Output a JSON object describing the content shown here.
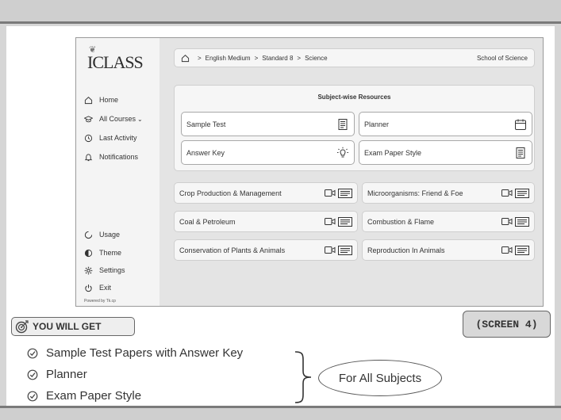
{
  "app": {
    "logo": "ICLASS",
    "sidebar": {
      "top_items": [
        {
          "label": "Home",
          "icon": "home-icon"
        },
        {
          "label": "All Courses",
          "icon": "graduation-cap-icon"
        },
        {
          "label": "Last Activity",
          "icon": "history-icon"
        },
        {
          "label": "Notifications",
          "icon": "bell-icon"
        }
      ],
      "bottom_items": [
        {
          "label": "Usage",
          "icon": "pie-chart-icon"
        },
        {
          "label": "Theme",
          "icon": "contrast-icon"
        },
        {
          "label": "Settings",
          "icon": "gear-icon"
        },
        {
          "label": "Exit",
          "icon": "power-icon"
        }
      ],
      "powered_by": "Powered by Tk.cp"
    },
    "breadcrumb": {
      "items": [
        "English Medium",
        "Standard 8",
        "Science"
      ],
      "separator": ">",
      "school": "School of Science"
    },
    "resources": {
      "title": "Subject-wise Resources",
      "cards": [
        {
          "label": "Sample Test",
          "icon": "document-list-icon"
        },
        {
          "label": "Planner",
          "icon": "calendar-icon"
        },
        {
          "label": "Answer Key",
          "icon": "lightbulb-icon"
        },
        {
          "label": "Exam Paper Style",
          "icon": "document-list-icon"
        }
      ]
    },
    "chapters": [
      "Crop Production & Management",
      "Microorganisms: Friend & Foe",
      "Coal & Petroleum",
      "Combustion & Flame",
      "Conservation of Plants & Animals",
      "Reproduction In Animals"
    ]
  },
  "you_will_get": "YOU WILL GET",
  "screen_label": "(SCREEN 4)",
  "benefits": [
    "Sample Test Papers with Answer Key",
    "Planner",
    "Exam Paper Style"
  ],
  "for_all_subjects": "For All Subjects"
}
